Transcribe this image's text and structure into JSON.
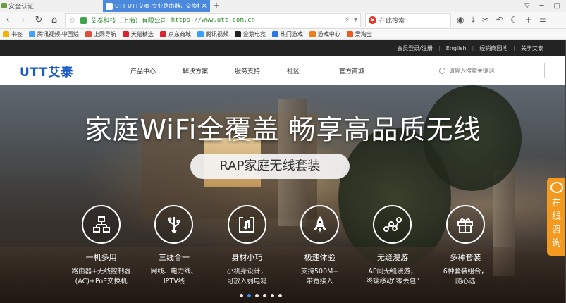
{
  "browser": {
    "security_label": "安全认证",
    "active_tab": "UTT UTT艾泰-专业路由器，交换机，防火",
    "tab_close": "×",
    "new_tab": "+",
    "window_controls": [
      "▽",
      "─",
      "□"
    ],
    "address_site_name": "艾泰科技（上海）有限公司",
    "address_url": "https://www.utt.com.cn",
    "search_placeholder": "在此搜索",
    "bookmarks": [
      {
        "label": "书签",
        "color": "#f2b400"
      },
      {
        "label": "腾讯视频-中国综",
        "color": "#43a0ff"
      },
      {
        "label": "上网导航",
        "color": "#e04e3c"
      },
      {
        "label": "天猫精选",
        "color": "#e0202a"
      },
      {
        "label": "京东商城",
        "color": "#d8262e"
      },
      {
        "label": "腾讯视频",
        "color": "#33a1ff"
      },
      {
        "label": "企鹅电竞",
        "color": "#222222"
      },
      {
        "label": "热门游戏",
        "color": "#2b77e6"
      },
      {
        "label": "游戏中心",
        "color": "#ef7d1a"
      },
      {
        "label": "爱淘宝",
        "color": "#ef5a1a"
      }
    ]
  },
  "site": {
    "top_links": [
      "会员登录/注册",
      "English",
      "经销商园地",
      "关于艾泰"
    ],
    "logo": "UTT艾泰",
    "nav": [
      "产品中心",
      "解决方案",
      "服务支持",
      "社区",
      "官方商城"
    ],
    "search_placeholder": "请输入搜索关键词"
  },
  "banner": {
    "headline": "家庭WiFi全覆盖  畅享高品质无线",
    "pill": "RAP家庭无线套装",
    "features": [
      {
        "icon": "grid-icon",
        "title": "一机多用",
        "desc1": "路由器+无线控制器",
        "desc2": "(AC)+PoE交换机"
      },
      {
        "icon": "usb-icon",
        "title": "三线合一",
        "desc1": "网线、电力线、",
        "desc2": "IPTV线"
      },
      {
        "icon": "small-device-icon",
        "title": "身材小巧",
        "desc1": "小机身设计，",
        "desc2": "可放入弱电箱"
      },
      {
        "icon": "rocket-icon",
        "title": "极速体验",
        "desc1": "支持500M+",
        "desc2": "带宽接入"
      },
      {
        "icon": "roaming-icon",
        "title": "无缝漫游",
        "desc1": "AP间无缝漫游，",
        "desc2": "终端移动\"零丢包\""
      },
      {
        "icon": "gift-icon",
        "title": "多种套装",
        "desc1": "6种套装组合，",
        "desc2": "随心选"
      }
    ],
    "slide_count": 6,
    "active_slide": 1
  },
  "chat": {
    "label": [
      "在",
      "线",
      "咨",
      "询"
    ]
  }
}
